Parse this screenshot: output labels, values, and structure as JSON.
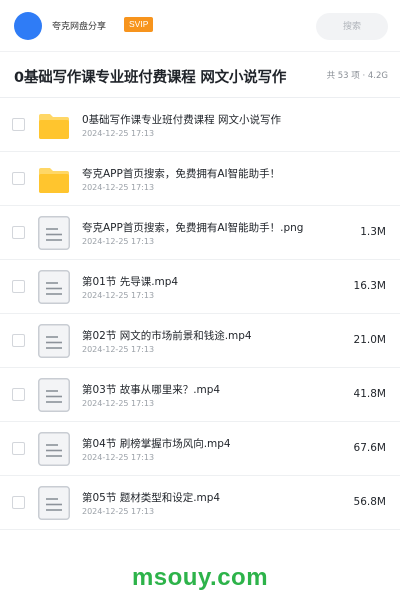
{
  "header": {
    "app_name": "夸克网盘分享",
    "badge": "SVIP",
    "search_placeholder": "搜索"
  },
  "folder": {
    "title": "0基础写作课专业班付费课程 网文小说写作",
    "meta": "共 53 项 · 4.2G"
  },
  "files": [
    {
      "type": "folder",
      "name": "0基础写作课专业班付费课程 网文小说写作",
      "date": "2024-12-25 17:13",
      "size": ""
    },
    {
      "type": "folder",
      "name": "夸克APP首页搜索，免费拥有AI智能助手！",
      "date": "2024-12-25 17:13",
      "size": ""
    },
    {
      "type": "file",
      "name": "夸克APP首页搜索，免费拥有AI智能助手！.png",
      "date": "2024-12-25 17:13",
      "size": "1.3M"
    },
    {
      "type": "file",
      "name": "第01节 先导课.mp4",
      "date": "2024-12-25 17:13",
      "size": "16.3M"
    },
    {
      "type": "file",
      "name": "第02节 网文的市场前景和钱途.mp4",
      "date": "2024-12-25 17:13",
      "size": "21.0M"
    },
    {
      "type": "file",
      "name": "第03节 故事从哪里来？.mp4",
      "date": "2024-12-25 17:13",
      "size": "41.8M"
    },
    {
      "type": "file",
      "name": "第04节 刷榜掌握市场风向.mp4",
      "date": "2024-12-25 17:13",
      "size": "67.6M"
    },
    {
      "type": "file",
      "name": "第05节 题材类型和设定.mp4",
      "date": "2024-12-25 17:13",
      "size": "56.8M"
    }
  ],
  "watermark": "msouy.com",
  "colors": {
    "brand_blue": "#2f7cf6",
    "svip_orange": "#f7941d",
    "folder_yellow": "#ffc52e",
    "watermark_green": "#2db34a"
  },
  "icons": {
    "folder": "folder-icon",
    "file": "document-icon"
  }
}
